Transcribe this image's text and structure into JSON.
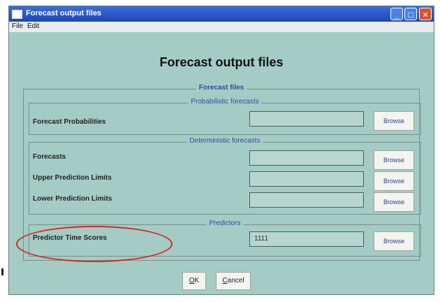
{
  "window": {
    "title": "Forecast output files",
    "menu": [
      "File",
      "Edit"
    ],
    "controls": {
      "minimize": "_",
      "maximize": "□",
      "close": "×"
    }
  },
  "main": {
    "heading": "Forecast output files",
    "forecast_files_legend": "Forecast files",
    "probabilistic": {
      "legend": "Probabilistic forecasts",
      "rows": [
        {
          "label": "Forecast Probabilities",
          "value": "",
          "button": "Browse"
        }
      ]
    },
    "deterministic": {
      "legend": "Deterministic forecasts",
      "rows": [
        {
          "label": "Forecasts",
          "value": "",
          "button": "Browse"
        },
        {
          "label": "Upper Prediction Limits",
          "value": "",
          "button": "Browse"
        },
        {
          "label": "Lower Prediction Limits",
          "value": "",
          "button": "Browse"
        }
      ]
    },
    "predictors": {
      "legend": "Predictors",
      "rows": [
        {
          "label": "Predictor Time Scores",
          "value": "1111",
          "button": "Browse"
        }
      ]
    },
    "actions": {
      "ok": "OK",
      "cancel": "Cancel"
    }
  },
  "annotation": {
    "highlight_color": "#d12a2a"
  }
}
